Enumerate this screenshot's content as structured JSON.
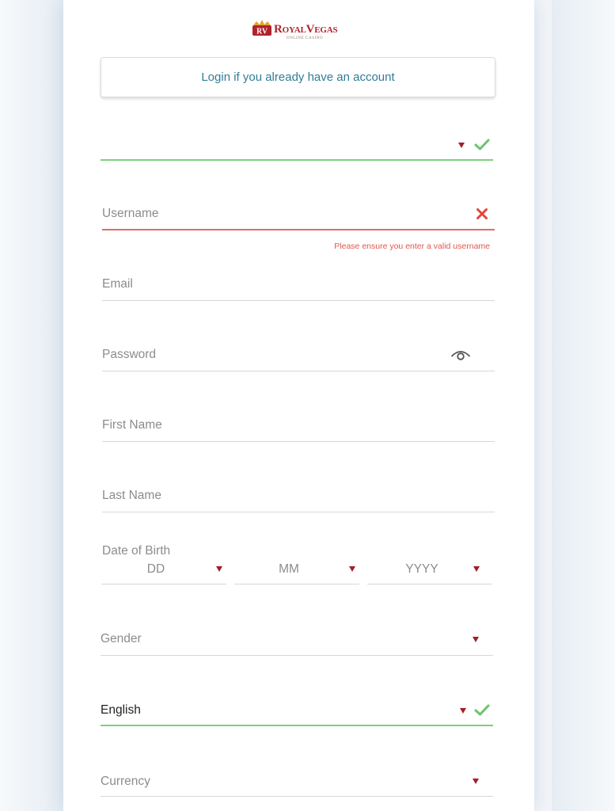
{
  "brand": {
    "name": "RoyalVegas",
    "tagline": "ONLINE CASINO",
    "logo_mark": "RV",
    "colors": {
      "primary": "#b0232c",
      "gold": "#e2a32a",
      "link": "#2f7d96"
    }
  },
  "login_button": {
    "label": "Login if you already have an account"
  },
  "form": {
    "country": {
      "value": "",
      "status": "valid"
    },
    "username": {
      "placeholder": "Username",
      "status": "invalid",
      "error": "Please ensure you enter a valid username"
    },
    "email": {
      "placeholder": "Email"
    },
    "password": {
      "placeholder": "Password",
      "icon": "eye-icon"
    },
    "first_name": {
      "placeholder": "First Name"
    },
    "last_name": {
      "placeholder": "Last Name"
    },
    "dob": {
      "label": "Date of Birth",
      "day": "DD",
      "month": "MM",
      "year": "YYYY"
    },
    "gender": {
      "placeholder": "Gender"
    },
    "language": {
      "value": "English",
      "status": "valid"
    },
    "currency": {
      "placeholder": "Currency"
    }
  },
  "status_colors": {
    "valid": "#7ed07e",
    "invalid": "#e06a6a",
    "caret": "#a11f25"
  }
}
